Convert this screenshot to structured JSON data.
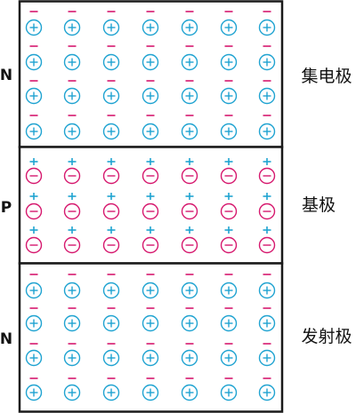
{
  "colors": {
    "positive": "#1fa3d1",
    "negative": "#d6186e",
    "border": "#1a1a1a"
  },
  "grid": {
    "columns": 7
  },
  "regions": [
    {
      "type": "N",
      "name": "集电极",
      "rows": 4,
      "ion": "positive",
      "ion_symbol": "+",
      "carrier": "negative",
      "carrier_symbol": "−"
    },
    {
      "type": "P",
      "name": "基极",
      "rows": 3,
      "ion": "negative",
      "ion_symbol": "−",
      "carrier": "positive",
      "carrier_symbol": "+"
    },
    {
      "type": "N",
      "name": "发射极",
      "rows": 4,
      "ion": "positive",
      "ion_symbol": "+",
      "carrier": "negative",
      "carrier_symbol": "−"
    }
  ]
}
